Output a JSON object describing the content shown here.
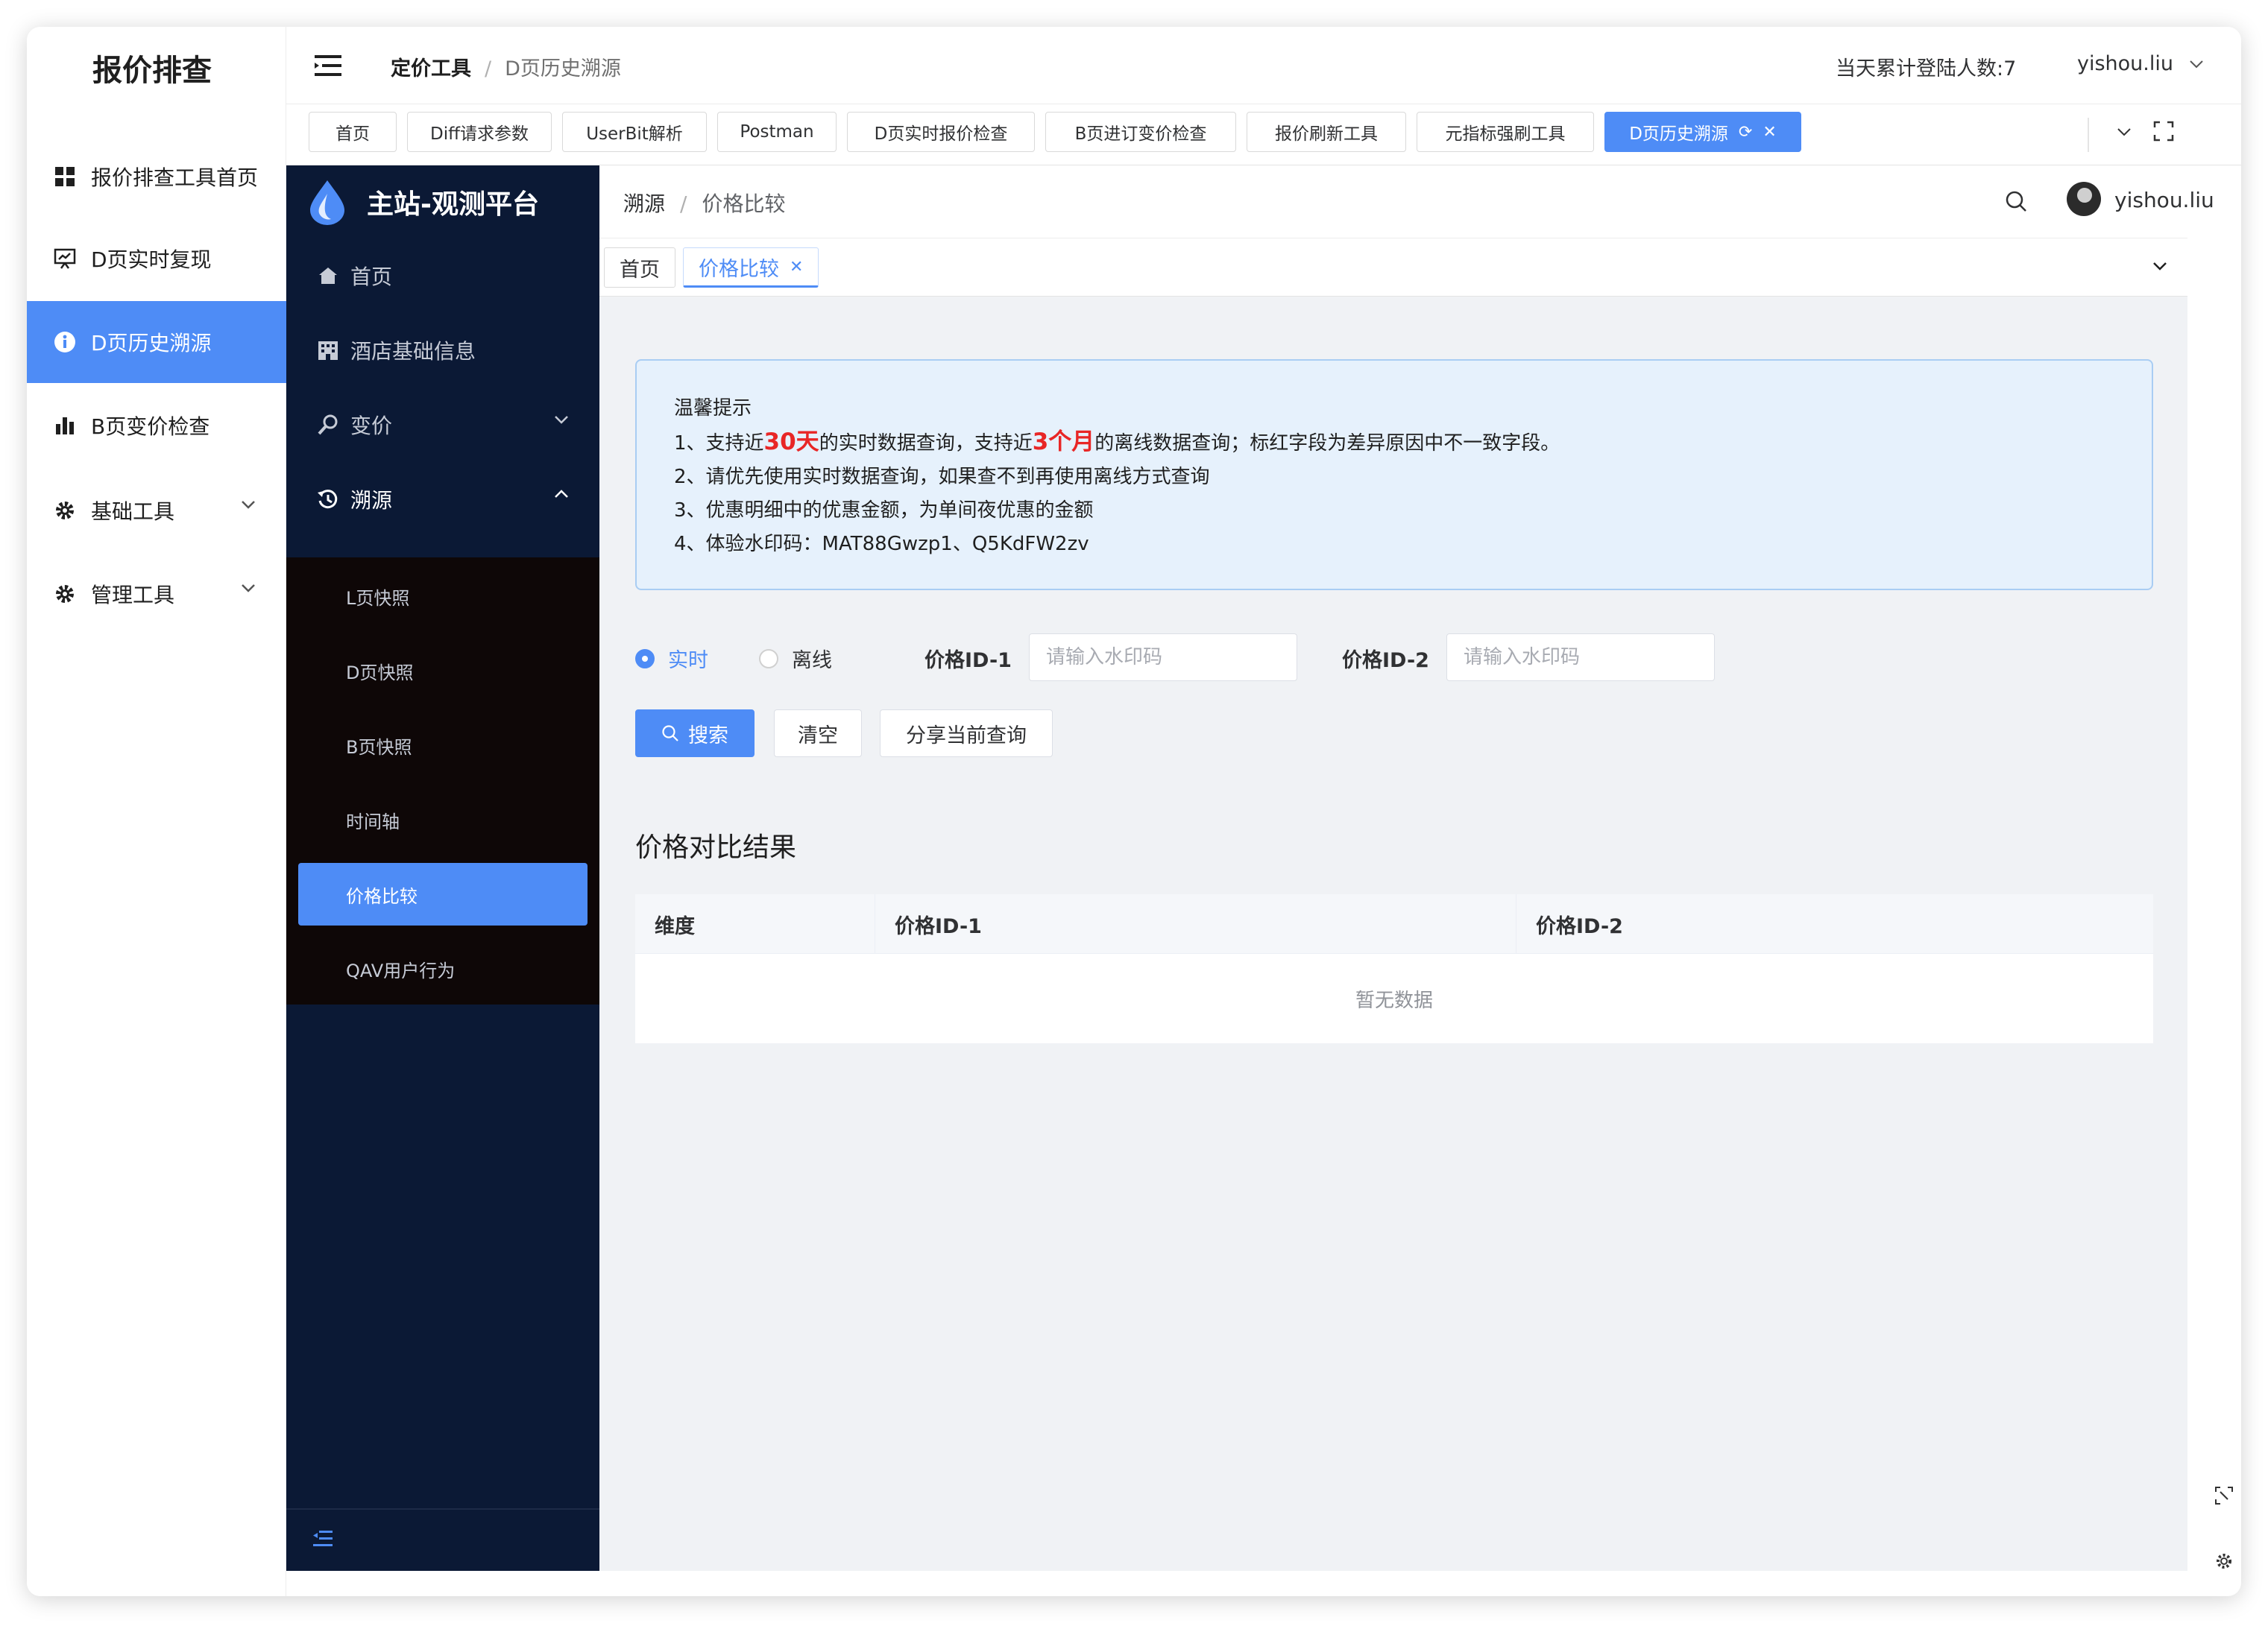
{
  "outer": {
    "title": "报价排查",
    "items": [
      {
        "label": "报价排查工具首页",
        "icon": "grid-icon"
      },
      {
        "label": "D页实时复现",
        "icon": "presentation-icon"
      },
      {
        "label": "D页历史溯源",
        "icon": "info-icon",
        "active": true
      },
      {
        "label": "B页变价检查",
        "icon": "bar-chart-icon"
      },
      {
        "label": "基础工具",
        "icon": "gear-icon"
      },
      {
        "label": "管理工具",
        "icon": "gear-icon"
      }
    ]
  },
  "top_header": {
    "breadcrumb": [
      "定价工具",
      "D页历史溯源"
    ],
    "login_count": "当天累计登陆人数:7",
    "user": "yishou.liu"
  },
  "tags": [
    "首页",
    "Diff请求参数",
    "UserBit解析",
    "Postman",
    "D页实时报价检查",
    "B页进订变价检查",
    "报价刷新工具",
    "元指标强刷工具",
    "D页历史溯源"
  ],
  "inner": {
    "brand": "主站-观测平台",
    "nav": [
      {
        "label": "首页",
        "icon": "home-icon"
      },
      {
        "label": "酒店基础信息",
        "icon": "building-icon"
      },
      {
        "label": "变价",
        "icon": "wrench-icon"
      },
      {
        "label": "溯源",
        "icon": "history-icon"
      }
    ],
    "submenu": [
      "L页快照",
      "D页快照",
      "B页快照",
      "时间轴",
      "价格比较",
      "QAV用户行为"
    ],
    "breadcrumb": [
      "溯源",
      "价格比较"
    ],
    "user": "yishou.liu",
    "tabs": [
      "首页",
      "价格比较"
    ]
  },
  "notice": {
    "title": "温馨提示",
    "line1_a": "1、支持近",
    "line1_h1": "30天",
    "line1_b": "的实时数据查询，支持近",
    "line1_h2": "3个月",
    "line1_c": "的离线数据查询；标红字段为差异原因中不一致字段。",
    "line2": "2、请优先使用实时数据查询，如果查不到再使用离线方式查询",
    "line3": "3、优惠明细中的优惠金额，为单间夜优惠的金额",
    "line4": "4、体验水印码：MAT88Gwzp1、Q5KdFW2zv"
  },
  "form": {
    "radio_realtime": "实时",
    "radio_offline": "离线",
    "label_id1": "价格ID-1",
    "label_id2": "价格ID-2",
    "placeholder": "请输入水印码",
    "btn_search": "搜索",
    "btn_clear": "清空",
    "btn_share": "分享当前查询"
  },
  "result": {
    "title": "价格对比结果",
    "columns": [
      "维度",
      "价格ID-1",
      "价格ID-2"
    ],
    "empty": "暂无数据"
  },
  "colors": {
    "primary": "#4e8cf6",
    "sidebar_dark": "#0b1935",
    "highlight_red": "#e82626"
  }
}
